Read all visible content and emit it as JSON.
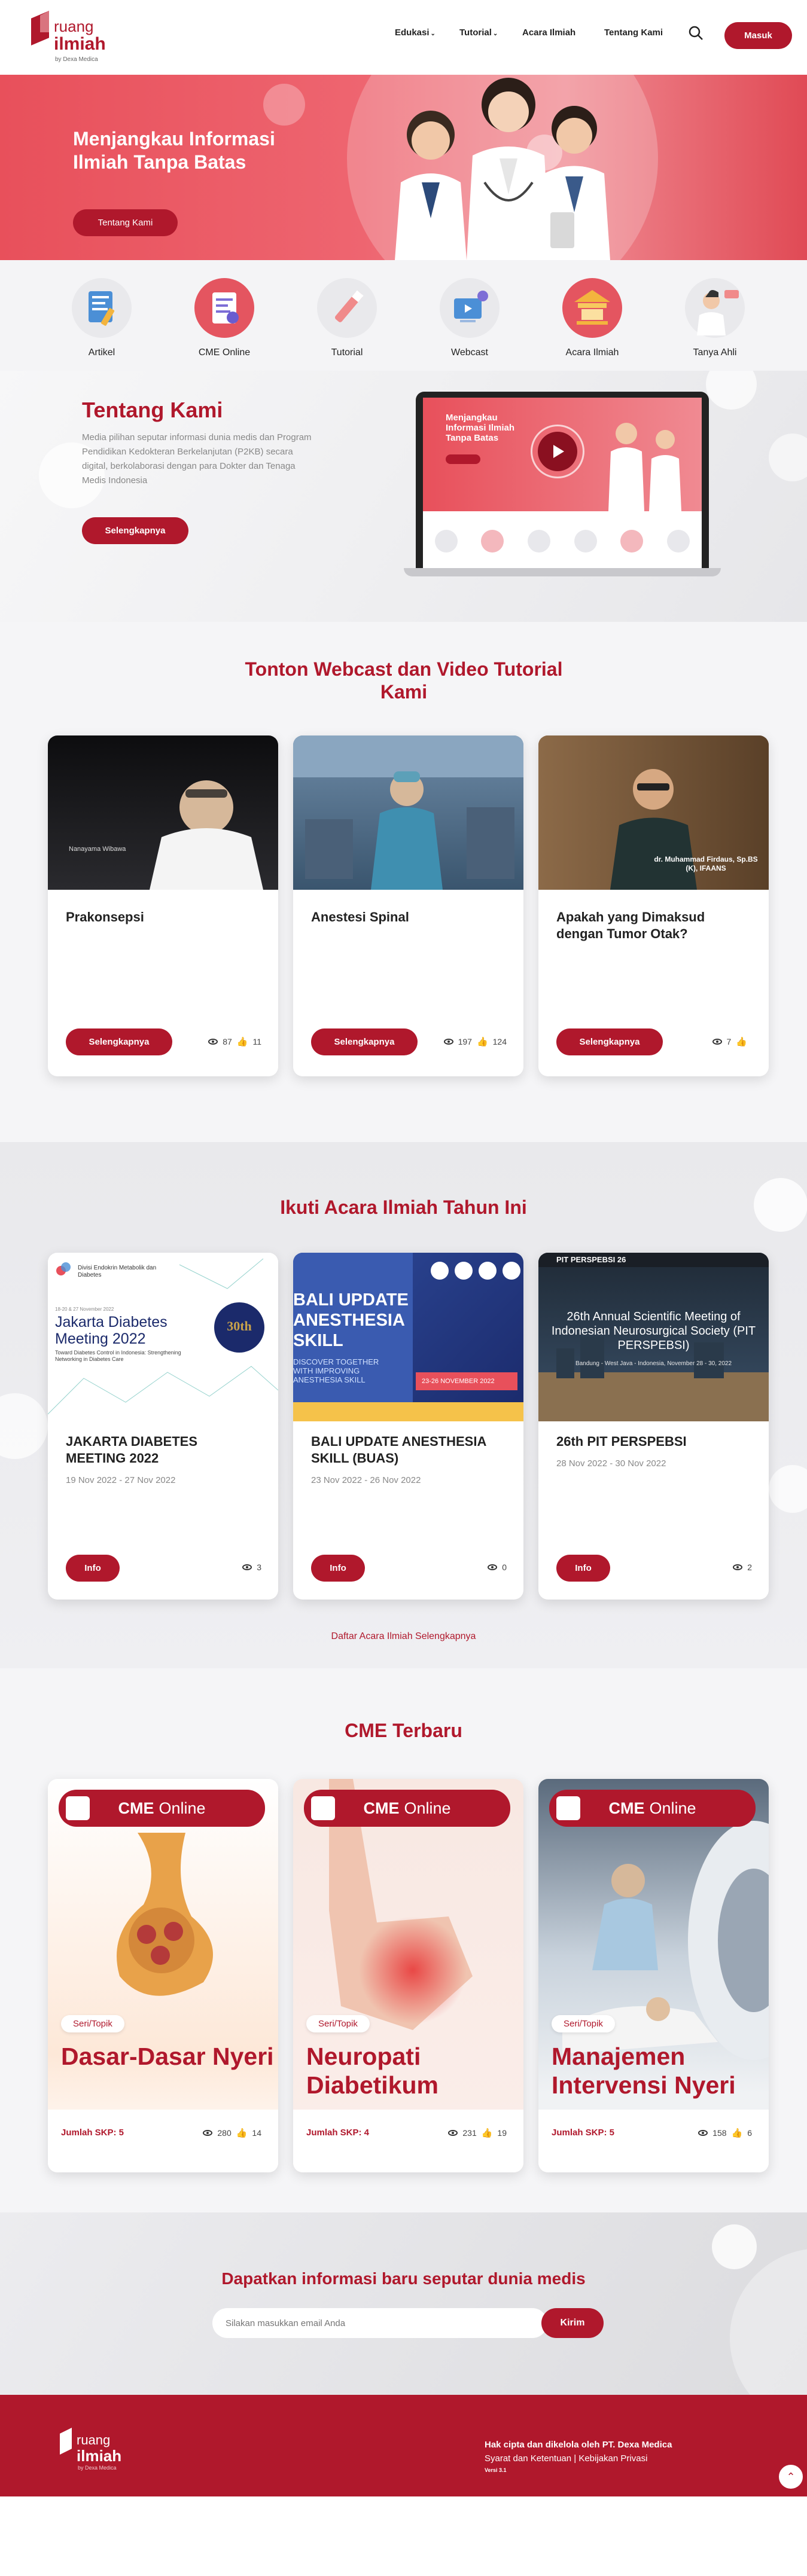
{
  "brand": {
    "line1": "ruang",
    "line2": "ilmiah",
    "line3": "by Dexa Medica"
  },
  "nav": {
    "edukasi": "Edukasi",
    "tutorial": "Tutorial",
    "acara": "Acara Ilmiah",
    "tentang": "Tentang Kami",
    "login": "Masuk"
  },
  "hero": {
    "title": "Menjangkau Informasi Ilmiah Tanpa Batas",
    "button": "Tentang Kami"
  },
  "categories": [
    {
      "label": "Artikel",
      "icon": "article-icon"
    },
    {
      "label": "CME Online",
      "icon": "cme-icon"
    },
    {
      "label": "Tutorial",
      "icon": "tutorial-icon"
    },
    {
      "label": "Webcast",
      "icon": "webcast-icon"
    },
    {
      "label": "Acara Ilmiah",
      "icon": "event-icon"
    },
    {
      "label": "Tanya Ahli",
      "icon": "doctor-icon"
    }
  ],
  "about": {
    "title": "Tentang Kami",
    "text": "Media pilihan seputar informasi dunia medis dan Program Pendidikan Kedokteran Berkelanjutan (P2KB) secara digital, berkolaborasi dengan para Dokter dan Tenaga Medis Indonesia",
    "button": "Selengkapnya",
    "screen_title": "Menjangkau Informasi Ilmiah Tanpa Batas"
  },
  "webcast": {
    "title": "Tonton Webcast dan Video Tutorial Kami",
    "cards": [
      {
        "title": "Prakonsepsi",
        "button": "Selengkapnya",
        "views": "87",
        "likes": "11",
        "caption": "Nanayama Wibawa"
      },
      {
        "title": "Anestesi Spinal",
        "button": "Selengkapnya",
        "views": "197",
        "likes": "124",
        "caption": ""
      },
      {
        "title": "Apakah yang Dimaksud dengan Tumor Otak?",
        "button": "Selengkapnya",
        "views": "7",
        "likes": "",
        "caption": "dr. Muhammad Firdaus, Sp.BS (K), IFAANS"
      }
    ]
  },
  "events": {
    "title": "Ikuti Acara Ilmiah Tahun Ini",
    "more": "Daftar Acara Ilmiah Selengkapnya",
    "cards": [
      {
        "title": "JAKARTA DIABETES MEETING 2022",
        "date": "19 Nov 2022 - 27 Nov 2022",
        "button": "Info",
        "views": "3",
        "poster": "Jakarta Diabetes Meeting 2022",
        "poster_sub": "Toward Diabetes Control in Indonesia: Strengthening Networking in Diabetes Care",
        "poster_top": "Divisi Endokrin Metabolik dan Diabetes",
        "poster_date": "18-20 & 27 November 2022"
      },
      {
        "title": "BALI UPDATE ANESTHESIA SKILL (BUAS)",
        "date": "23 Nov 2022 - 26 Nov 2022",
        "button": "Info",
        "views": "0",
        "poster": "BALI UPDATE ANESTHESIA SKILL",
        "poster_sub": "DISCOVER TOGETHER WITH IMPROVING ANESTHESIA SKILL",
        "poster_date": "23-26 NOVEMBER 2022"
      },
      {
        "title": "26th PIT PERSPEBSI",
        "date": "28 Nov 2022 - 30 Nov 2022",
        "button": "Info",
        "views": "2",
        "poster": "26th Annual Scientific Meeting of Indonesian Neurosurgical Society (PIT PERSPEBSI)",
        "poster_sub": "Bandung - West Java - Indonesia, November 28 - 30, 2022",
        "poster_top": "PIT PERSPEBSI 26"
      }
    ]
  },
  "cme": {
    "title": "CME Terbaru",
    "cards": [
      {
        "head_bold": "CME",
        "head": "Online",
        "tag": "Seri/Topik",
        "name": "Dasar-Dasar Nyeri",
        "skp": "Jumlah SKP: 5",
        "views": "280",
        "likes": "14"
      },
      {
        "head_bold": "CME",
        "head": "Online",
        "tag": "Seri/Topik",
        "name": "Neuropati Diabetikum",
        "skp": "Jumlah SKP: 4",
        "views": "231",
        "likes": "19"
      },
      {
        "head_bold": "CME",
        "head": "Online",
        "tag": "Seri/Topik",
        "name": "Manajemen Intervensi Nyeri",
        "skp": "Jumlah SKP: 5",
        "views": "158",
        "likes": "6"
      }
    ]
  },
  "newsletter": {
    "title": "Dapatkan informasi baru seputar dunia medis",
    "placeholder": "Silakan masukkan email Anda",
    "button": "Kirim"
  },
  "footer": {
    "copyright": "Hak cipta dan dikelola oleh PT. Dexa Medica",
    "links": "Syarat dan Ketentuan | Kebijakan Privasi",
    "version": "Versi 3.1"
  },
  "colors": {
    "brand": "#b0182c",
    "hero": "#e8505b"
  }
}
